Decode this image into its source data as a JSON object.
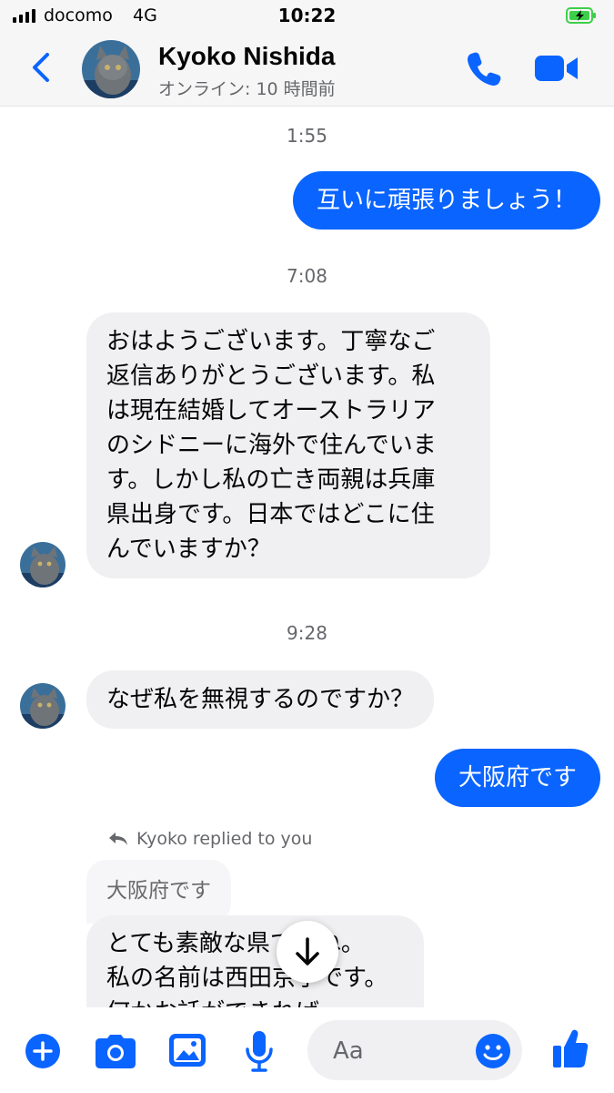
{
  "status_bar": {
    "carrier": "docomo",
    "network": "4G",
    "time": "10:22"
  },
  "header": {
    "name": "Kyoko Nishida",
    "status": "オンライン: 10 時間前"
  },
  "messages": {
    "t1": "1:55",
    "out1": "互いに頑張りましょう！",
    "t2": "7:08",
    "in1_lines": [
      "おはようございます。丁寧なご",
      "返信ありがとうございます。私",
      "は現在結婚してオーストラリア",
      "のシドニーに海外で住んでいま",
      "す。しかし私の亡き両親は兵庫",
      "県出身です。日本ではどこに住",
      "んでいますか？"
    ],
    "t3": "9:28",
    "in2": "なぜ私を無視するのですか？",
    "out2": "大阪府です",
    "reply_label": "Kyoko replied to you",
    "quoted": "大阪府です",
    "in3_lines": [
      "とても素敵な県ですね。",
      "私の名前は西田京子です。",
      "何かお話ができれば"
    ]
  },
  "composer": {
    "placeholder": "Aa"
  },
  "colors": {
    "accent": "#0a64ff",
    "incoming_bubble": "#f0f0f2",
    "battery_green": "#3ecf4a"
  },
  "icons": [
    "back-icon",
    "phone-icon",
    "video-icon",
    "reply-icon",
    "arrow-down-icon",
    "plus-icon",
    "camera-icon",
    "image-icon",
    "microphone-icon",
    "emoji-icon",
    "thumbs-up-icon"
  ]
}
